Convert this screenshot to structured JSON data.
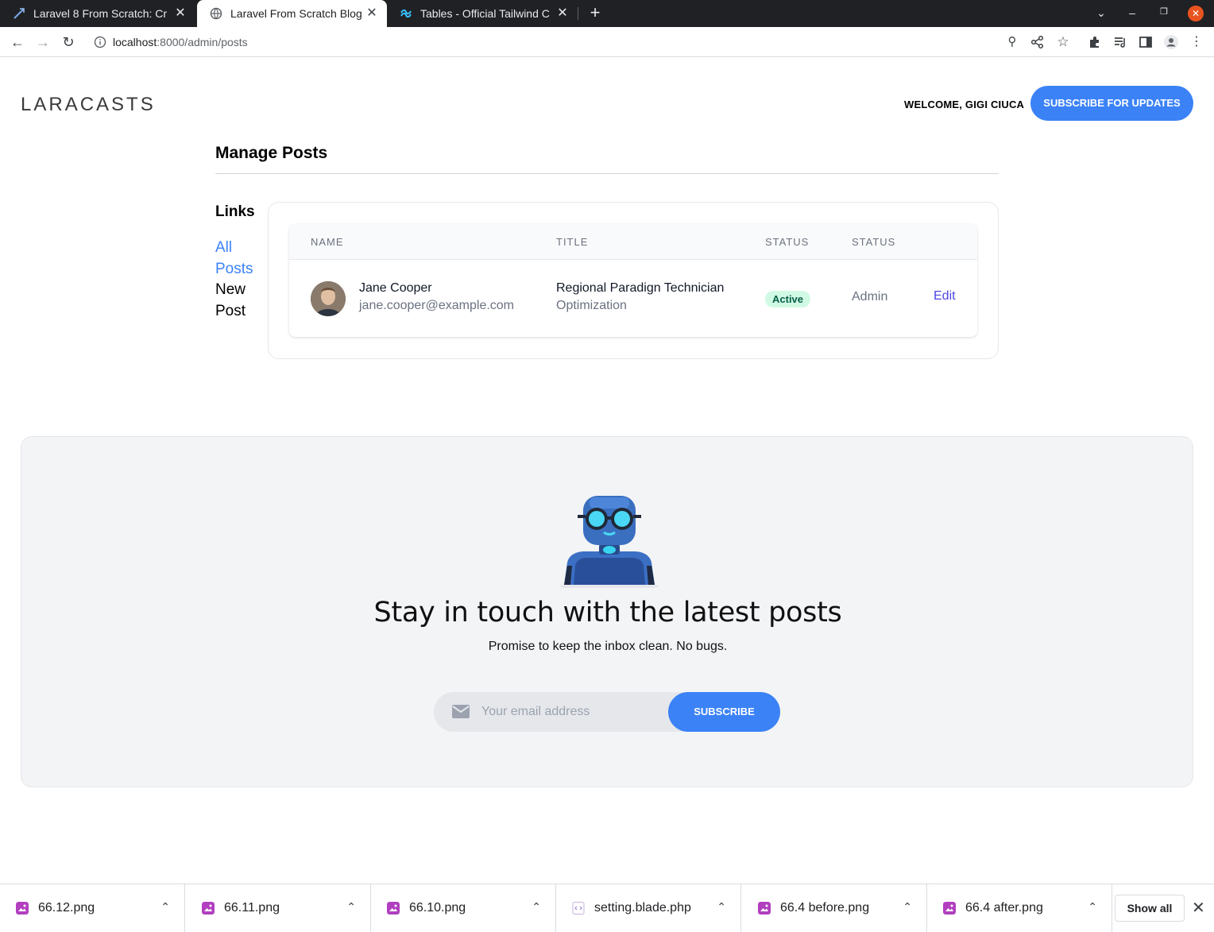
{
  "browser": {
    "tabs": [
      {
        "title": "Laravel 8 From Scratch: Cr",
        "active": false
      },
      {
        "title": "Laravel From Scratch Blog",
        "active": true
      },
      {
        "title": "Tables - Official Tailwind C",
        "active": false
      }
    ],
    "url_host": "localhost",
    "url_rest": ":8000/admin/posts"
  },
  "header": {
    "logo": "LARACASTS",
    "welcome": "WELCOME, GIGI CIUCA",
    "subscribe_label": "SUBSCRIBE FOR UPDATES"
  },
  "page": {
    "title": "Manage Posts",
    "links_title": "Links",
    "links": [
      {
        "line1": "All",
        "line2": "Posts"
      },
      {
        "line1": "New",
        "line2": "Post"
      }
    ]
  },
  "table": {
    "headers": [
      "NAME",
      "TITLE",
      "STATUS",
      "STATUS"
    ],
    "rows": [
      {
        "name": "Jane Cooper",
        "email": "jane.cooper@example.com",
        "title": "Regional Paradign Technician",
        "subtitle": "Optimization",
        "status": "Active",
        "role": "Admin",
        "action": "Edit"
      }
    ]
  },
  "newsletter": {
    "title": "Stay in touch with the latest posts",
    "subtitle": "Promise to keep the inbox clean. No bugs.",
    "email_placeholder": "Your email address",
    "button_label": "SUBSCRIBE"
  },
  "downloads": {
    "items": [
      {
        "name": "66.12.png",
        "icon": "image-file-icon"
      },
      {
        "name": "66.11.png",
        "icon": "image-file-icon"
      },
      {
        "name": "66.10.png",
        "icon": "image-file-icon"
      },
      {
        "name": "setting.blade.php",
        "icon": "code-file-icon"
      },
      {
        "name": "66.4 before.png",
        "icon": "image-file-icon"
      },
      {
        "name": "66.4 after.png",
        "icon": "image-file-icon"
      }
    ],
    "show_all": "Show all"
  },
  "colors": {
    "accent": "#3b82f6",
    "badge_bg": "#d1fae5",
    "badge_text": "#065f46",
    "edit_link": "#4f46e5"
  }
}
